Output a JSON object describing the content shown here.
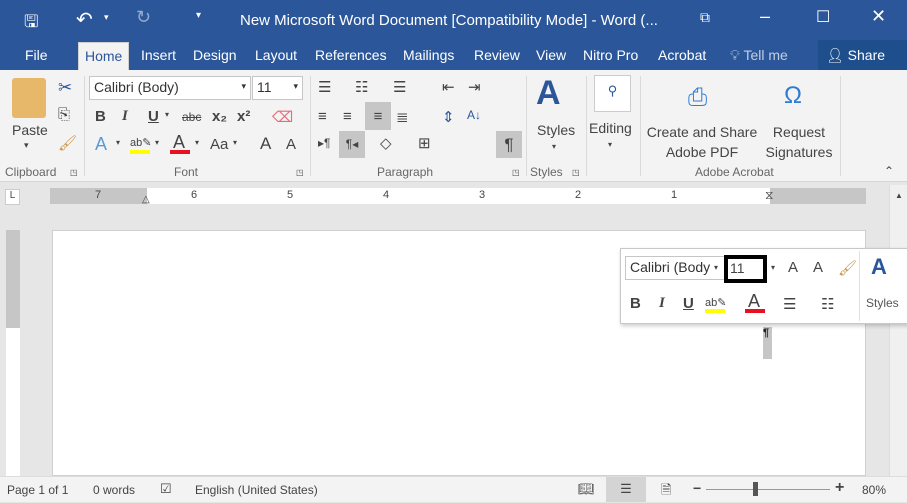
{
  "title": "New Microsoft Word Document [Compatibility Mode] - Word (...",
  "tabs": [
    "File",
    "Home",
    "Insert",
    "Design",
    "Layout",
    "References",
    "Mailings",
    "Review",
    "View",
    "Nitro Pro",
    "Acrobat"
  ],
  "tell_me": "Tell me",
  "share": "Share",
  "clipboard": {
    "paste": "Paste",
    "label": "Clipboard"
  },
  "font": {
    "name": "Calibri (Body)",
    "size": "11",
    "label": "Font",
    "bold": "B",
    "italic": "I",
    "underline": "U",
    "strike": "abc",
    "sub": "x₂",
    "sup": "x²",
    "case": "Aa",
    "grow": "A",
    "shrink": "A",
    "color_red": "#e81123",
    "highlight_yellow": "#ffff00"
  },
  "paragraph": {
    "label": "Paragraph",
    "pilcrow": "¶"
  },
  "styles": {
    "label": "Styles",
    "group": "Styles"
  },
  "editing": {
    "label": "Editing"
  },
  "acrobat": {
    "create": "Create and Share",
    "create2": "Adobe PDF",
    "request": "Request",
    "request2": "Signatures",
    "label": "Adobe Acrobat"
  },
  "ruler": {
    "numbers": [
      "7",
      "6",
      "5",
      "4",
      "3",
      "2",
      "1"
    ]
  },
  "mini_toolbar": {
    "font": "Calibri (Body",
    "size": "11",
    "styles": "Styles"
  },
  "document": {
    "pilcrow": "¶"
  },
  "status": {
    "page": "Page 1 of 1",
    "words": "0 words",
    "language": "English (United States)",
    "zoom": "80%",
    "zoom_minus": "−",
    "zoom_plus": "+"
  }
}
